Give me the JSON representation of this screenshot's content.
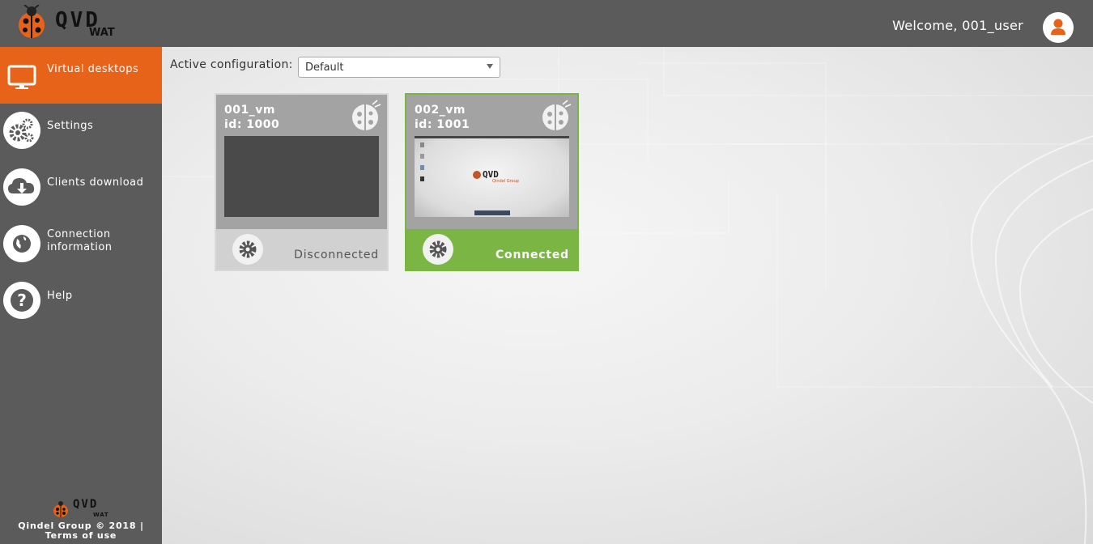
{
  "app": {
    "brand": "QVD",
    "sub": "WAT"
  },
  "header": {
    "welcome": "Welcome, 001_user"
  },
  "sidebar": {
    "items": [
      {
        "label": "Virtual desktops",
        "icon": "monitor-icon",
        "active": true
      },
      {
        "label": "Settings",
        "icon": "gears-icon"
      },
      {
        "label": "Clients download",
        "icon": "cloud-download-icon"
      },
      {
        "label": "Connection information",
        "icon": "globe-icon"
      },
      {
        "label": "Help",
        "icon": "question-icon"
      }
    ],
    "footer": {
      "copyright": "Qindel Group © 2018 | ",
      "terms": "Terms of use",
      "brand": "QVD",
      "sub": "WAT"
    }
  },
  "main": {
    "config_label": "Active configuration:",
    "config_value": "Default",
    "vms": [
      {
        "name": "001_vm",
        "id": "id: 1000",
        "status": "Disconnected"
      },
      {
        "name": "002_vm",
        "id": "id: 1001",
        "status": "Connected"
      }
    ],
    "screenshot_brand": "QVD",
    "screenshot_sub": "Qindel Group"
  },
  "colors": {
    "accent": "#e8631a",
    "connected": "#7bb543",
    "background": "#5b5b5b"
  }
}
